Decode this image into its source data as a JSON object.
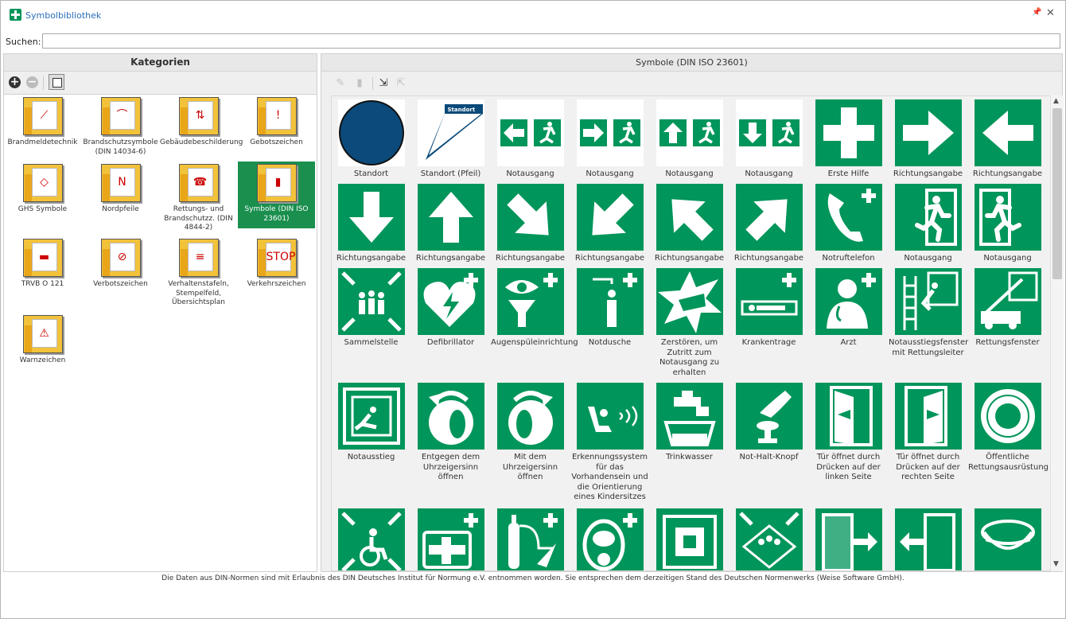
{
  "window": {
    "title": "Symbolbibliothek",
    "pin_icon": "pin-icon",
    "close_icon": "close-icon"
  },
  "search": {
    "label": "Suchen:",
    "value": "",
    "placeholder": ""
  },
  "left": {
    "header": "Kategorien"
  },
  "categories": [
    {
      "label": "Brandmeldetechnik",
      "glyph": "⟋"
    },
    {
      "label": "Brandschutzsymbole (DIN 14034-6)",
      "glyph": "⌒"
    },
    {
      "label": "Gebäudebeschilderung",
      "glyph": "⇅"
    },
    {
      "label": "Gebotszeichen",
      "glyph": "!"
    },
    {
      "label": "GHS Symbole",
      "glyph": "◇"
    },
    {
      "label": "Nordpfeile",
      "glyph": "N"
    },
    {
      "label": "Rettungs- und Brandschutzz. (DIN 4844-2)",
      "glyph": "☎"
    },
    {
      "label": "Symbole (DIN ISO 23601)",
      "glyph": "▮"
    },
    {
      "label": "TRVB O 121",
      "glyph": "▬"
    },
    {
      "label": "Verbotszeichen",
      "glyph": "⊘"
    },
    {
      "label": "Verhaltenstafeln, Stempelfeld, Übersichtsplan",
      "glyph": "≡"
    },
    {
      "label": "Verkehrszeichen",
      "glyph": "STOP"
    },
    {
      "label": "Warnzeichen",
      "glyph": "⚠"
    }
  ],
  "right": {
    "header": "Symbole (DIN ISO 23601)"
  },
  "toolbar": {
    "edit_icon": "pencil-icon",
    "delete_icon": "trash-icon",
    "import_icon": "import-icon",
    "export_icon": "export-icon"
  },
  "symbols": [
    {
      "label": "Standort",
      "icon": "location-dot"
    },
    {
      "label": "Standort (Pfeil)",
      "icon": "location-arrow",
      "tag": "Standort"
    },
    {
      "label": "Notausgang",
      "icon": "exit-left"
    },
    {
      "label": "Notausgang",
      "icon": "exit-right"
    },
    {
      "label": "Notausgang",
      "icon": "exit-up"
    },
    {
      "label": "Notausgang",
      "icon": "exit-down"
    },
    {
      "label": "Erste Hilfe",
      "icon": "first-aid-cross"
    },
    {
      "label": "Richtungsangabe",
      "icon": "arrow-right"
    },
    {
      "label": "Richtungsangabe",
      "icon": "arrow-left"
    },
    {
      "label": "Richtungsangabe",
      "icon": "arrow-down"
    },
    {
      "label": "Richtungsangabe",
      "icon": "arrow-up"
    },
    {
      "label": "Richtungsangabe",
      "icon": "arrow-down-right"
    },
    {
      "label": "Richtungsangabe",
      "icon": "arrow-down-left"
    },
    {
      "label": "Richtungsangabe",
      "icon": "arrow-up-left"
    },
    {
      "label": "Richtungsangabe",
      "icon": "arrow-up-right"
    },
    {
      "label": "Notruftelefon",
      "icon": "phone"
    },
    {
      "label": "Notausgang",
      "icon": "running-man-right"
    },
    {
      "label": "Notausgang",
      "icon": "running-man-left"
    },
    {
      "label": "Sammelstelle",
      "icon": "assembly"
    },
    {
      "label": "Defibrillator",
      "icon": "defibrillator"
    },
    {
      "label": "Augenspüleinrichtung",
      "icon": "eye-wash"
    },
    {
      "label": "Notdusche",
      "icon": "shower"
    },
    {
      "label": "Zerstören, um Zutritt zum Notausgang zu erhalten",
      "icon": "break-glass"
    },
    {
      "label": "Krankentrage",
      "icon": "stretcher"
    },
    {
      "label": "Arzt",
      "icon": "doctor"
    },
    {
      "label": "Notausstiegsfenster mit Rettungsleiter",
      "icon": "window-ladder"
    },
    {
      "label": "Rettungsfenster",
      "icon": "rescue-window"
    },
    {
      "label": "Notausstieg",
      "icon": "escape-hatch"
    },
    {
      "label": "Entgegen dem Uhrzeigersinn öffnen",
      "icon": "turn-ccw"
    },
    {
      "label": "Mit dem Uhrzeigersinn öffnen",
      "icon": "turn-cw"
    },
    {
      "label": "Erkennungssystem für das Vorhandensein und die Orientierung eines Kindersitzes",
      "icon": "child-seat"
    },
    {
      "label": "Trinkwasser",
      "icon": "tap"
    },
    {
      "label": "Not-Halt-Knopf",
      "icon": "stop-button"
    },
    {
      "label": "Tür öffnet durch Drücken auf der linken Seite",
      "icon": "door-left"
    },
    {
      "label": "Tür öffnet durch Drücken auf der rechten Seite",
      "icon": "door-right"
    },
    {
      "label": "Öffentliche Rettungsausrüstung",
      "icon": "lifebuoy"
    },
    {
      "label": "",
      "icon": "wheelchair"
    },
    {
      "label": "",
      "icon": "first-aid-bag"
    },
    {
      "label": "",
      "icon": "oxygen"
    },
    {
      "label": "",
      "icon": "breathing-mask"
    },
    {
      "label": "",
      "icon": "square-point"
    },
    {
      "label": "",
      "icon": "assembly-diamond"
    },
    {
      "label": "",
      "icon": "door-exit-right"
    },
    {
      "label": "",
      "icon": "door-exit-left"
    },
    {
      "label": "",
      "icon": "life-raft"
    }
  ],
  "footer": "Die Daten aus DIN-Normen sind mit Erlaubnis des DIN Deutsches Institut für Normung e.V. entnommen worden. Sie entsprechen dem derzeitigen Stand des Deutschen Normenwerks (Weise Software GmbH).",
  "colors": {
    "sign_green": "#00955a",
    "selection": "#1a8f4e",
    "title_blue": "#2a6ebb",
    "standort_blue": "#0b4a7a"
  }
}
